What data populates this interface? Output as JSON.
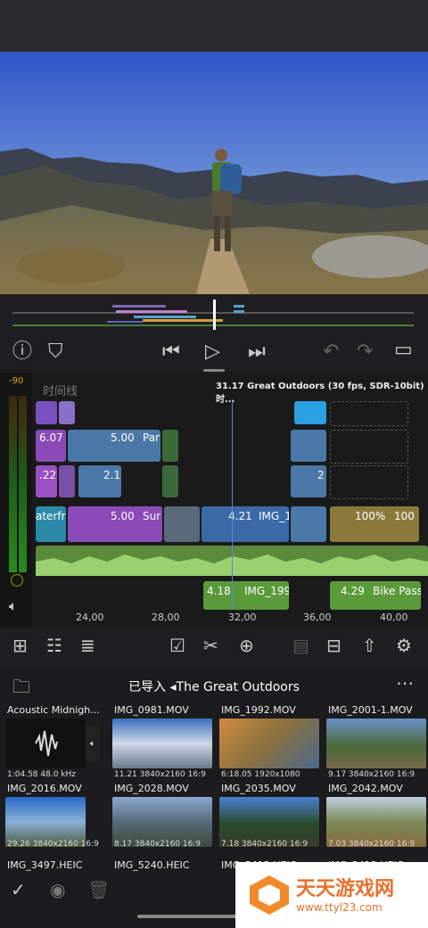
{
  "timeline": {
    "header": "时间线",
    "info": "31.17 Great Outdoors (30 fps, SDR-10bit) 时...",
    "meter_value": "-90",
    "clips": {
      "c1": "6.07",
      "c2": "5.00",
      "c3": "Par",
      "c4": ".22",
      "c5": "2.1",
      "c6": "aterfre",
      "c7": "5.00",
      "c8": "Sur",
      "c9": "4.21",
      "c10": "IMG_1",
      "c11": "100%",
      "c12": "100",
      "c13": "2",
      "a1_dur": "4.18",
      "a1_name": "IMG_199",
      "a2_dur": "4.29",
      "a2_name": "Bike Pass"
    },
    "ruler": [
      "24,00",
      "28,00",
      "32,00",
      "36,00",
      "40,00"
    ]
  },
  "browser": {
    "title": "已导入 ◂The Great Outdoors",
    "items": [
      {
        "name": "Acoustic Midnigh...",
        "meta": "1:04.58  48.0 kHz"
      },
      {
        "name": "IMG_0981.MOV",
        "meta": "11.21  3840x2160  16:9"
      },
      {
        "name": "IMG_1992.MOV",
        "meta": "6:18.05  1920x1080"
      },
      {
        "name": "IMG_2001-1.MOV",
        "meta": "9.17  3840x2160  16:9"
      },
      {
        "name": "IMG_2016.MOV",
        "meta": "29.26  3840x2160  16:9"
      },
      {
        "name": "IMG_2028.MOV",
        "meta": "8.17  3840x2160  16:9"
      },
      {
        "name": "IMG_2035.MOV",
        "meta": "7.18  3840x2160  16:9"
      },
      {
        "name": "IMG_2042.MOV",
        "meta": "7.03  3840x2160  16:9"
      },
      {
        "name": "IMG_3497.HEIC",
        "meta": ""
      },
      {
        "name": "IMG_5240.HEIC",
        "meta": ""
      },
      {
        "name": "IMG_5412.HEIC",
        "meta": ""
      },
      {
        "name": "IMG_5413.HEIC",
        "meta": ""
      }
    ]
  },
  "watermark": {
    "title": "天天游戏网",
    "url": "www.ttyl23.com"
  }
}
